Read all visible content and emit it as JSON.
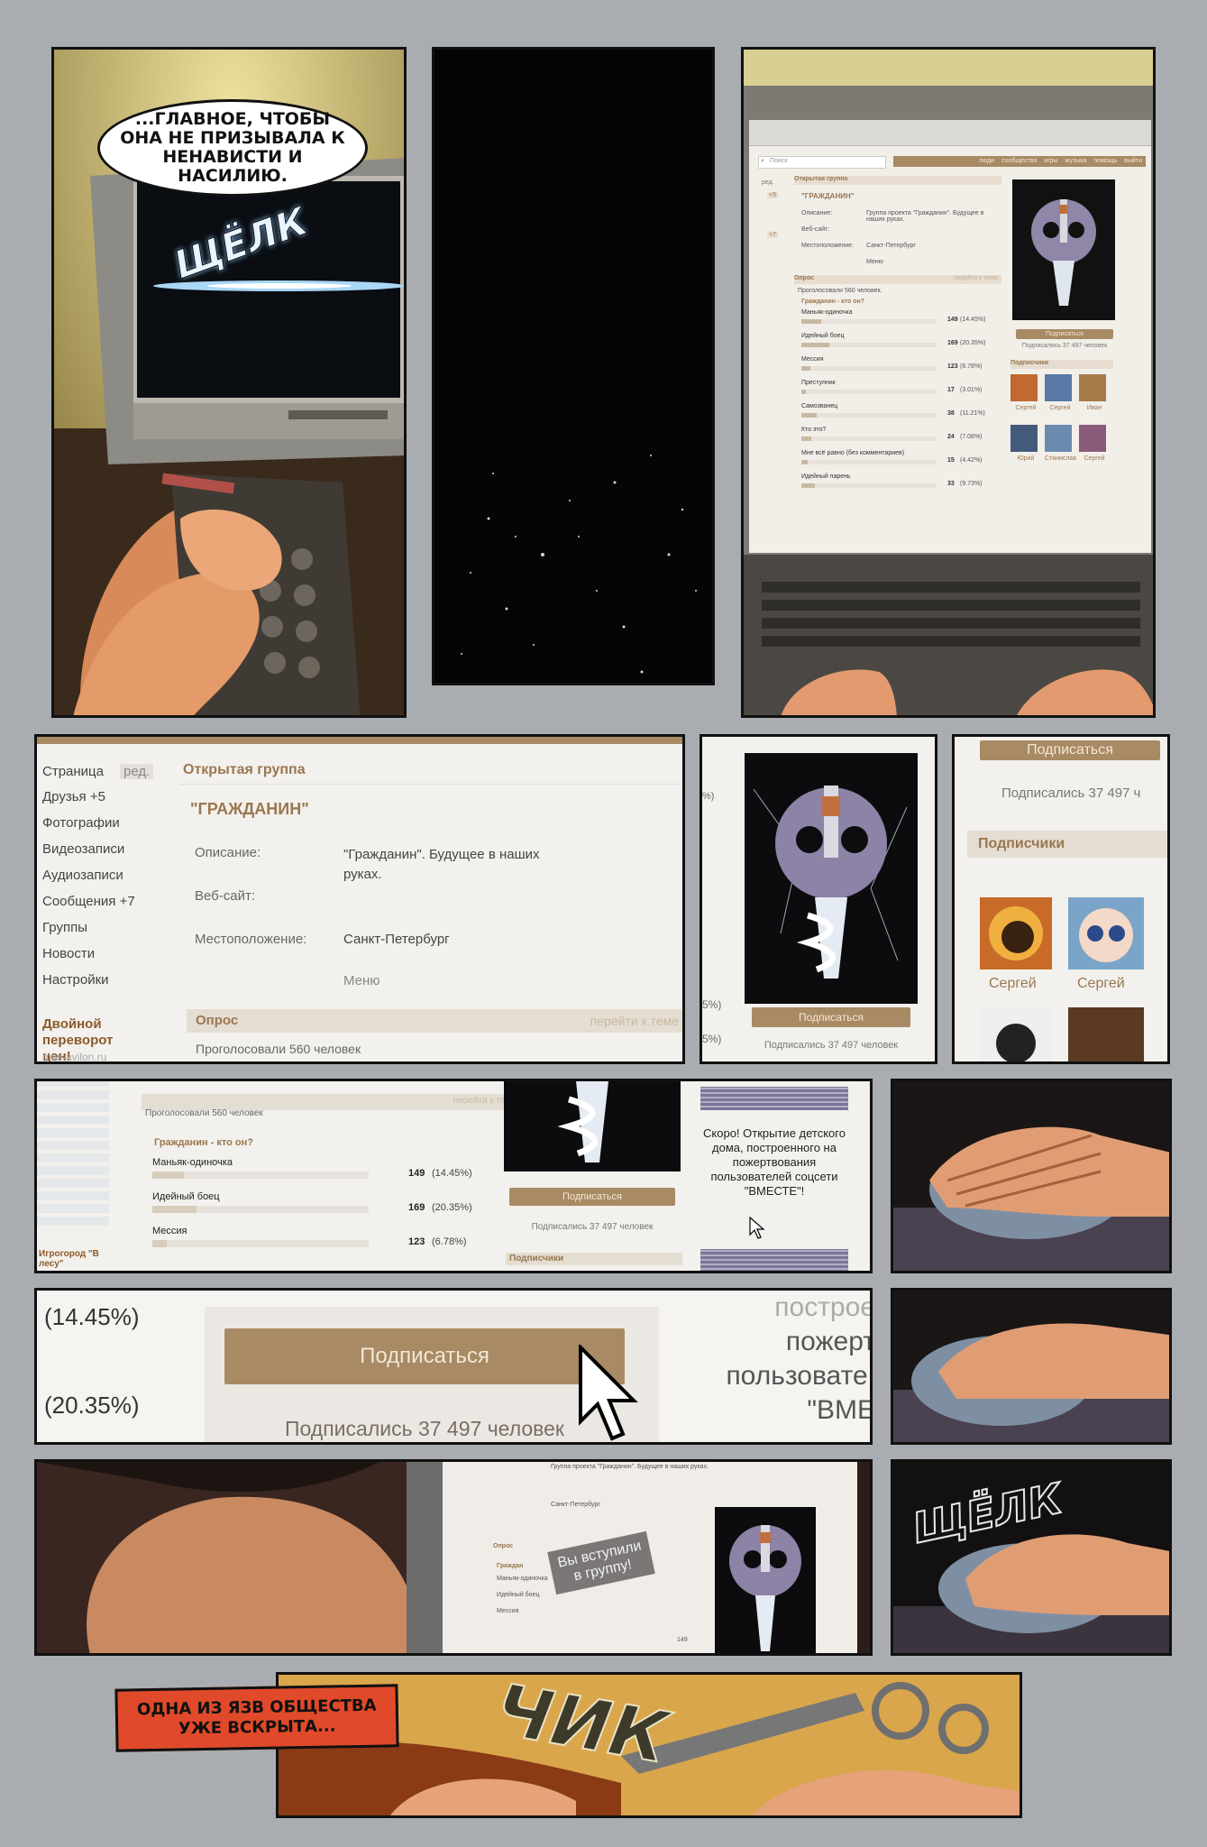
{
  "panel1": {
    "speech": "...главное, чтобы она не призывала к ненависти и насилию.",
    "sfx": "ЩЁЛК"
  },
  "vk_small": {
    "search_placeholder": "Поиск",
    "top_nav": [
      "люди",
      "сообщества",
      "игры",
      "музыка",
      "помощь",
      "выйти"
    ],
    "left_edit": "ред.",
    "left_badges": [
      "+5",
      "+7"
    ],
    "group_type": "Открытая группа",
    "group_name": "\"ГРАЖДАНИН\"",
    "desc_label": "Описание:",
    "desc_value": "Группа проекта \"Гражданин\". Будущее в наших руках.",
    "site_label": "Веб-сайт:",
    "location_label": "Местоположение:",
    "location_value": "Санкт-Петербург",
    "menu": "Меню",
    "poll_label": "Опрос",
    "poll_link": "перейти к теме",
    "poll_voted": "Проголосовали 560 человек.",
    "poll_question": "Гражданин - кто он?",
    "poll_options": [
      {
        "label": "Маньяк-одиночка",
        "count": "149",
        "pct": "(14.45%)",
        "share": 0.1445
      },
      {
        "label": "Идейный боец",
        "count": "169",
        "pct": "(20.35%)",
        "share": 0.2035
      },
      {
        "label": "Мессия",
        "count": "123",
        "pct": "(6.78%)",
        "share": 0.0678
      },
      {
        "label": "Преступник",
        "count": "17",
        "pct": "(3.01%)",
        "share": 0.0301
      },
      {
        "label": "Самозванец",
        "count": "38",
        "pct": "(11.21%)",
        "share": 0.1121
      },
      {
        "label": "Кто это?",
        "count": "24",
        "pct": "(7.08%)",
        "share": 0.0708
      },
      {
        "label": "Мне всё равно (без комментариев)",
        "count": "15",
        "pct": "(4.42%)",
        "share": 0.0442
      },
      {
        "label": "Идейный парень",
        "count": "33",
        "pct": "(9.73%)",
        "share": 0.0973
      }
    ],
    "subscribe_button": "Подписаться",
    "subscribed_count": "Подписались 37 497 человек",
    "subscribers_title": "Подписчики",
    "subscriber_names": [
      "Сергей",
      "Сергей",
      "Иван",
      "Юрий",
      "Станислав",
      "Сергей"
    ]
  },
  "panel4": {
    "left_menu": [
      "Страница",
      "Друзья +5",
      "Фотографии",
      "Видеозаписи",
      "Аудиозаписи",
      "Сообщения +7",
      "Группы",
      "Новости",
      "Настройки"
    ],
    "left_edit": "ред.",
    "ad_title": "Двойной переворот цен!",
    "ad_link": "mini-avilon.ru",
    "group_type": "Открытая группа",
    "group_name": "\"ГРАЖДАНИН\"",
    "desc_label": "Описание:",
    "desc_value": "\"Гражданин\". Будущее в наших руках.",
    "site_label": "Веб-сайт:",
    "location_label": "Местоположение:",
    "location_value": "Санкт-Петербург",
    "menu": "Меню",
    "poll_label": "Опрос",
    "poll_link": "перейти к теме",
    "poll_voted": "Проголосовали 560 человек"
  },
  "panel5": {
    "pcts": [
      "%)",
      "5%)",
      "5%)"
    ],
    "button": "Подписаться",
    "subscribed": "Подписались 37 497 человек"
  },
  "panel6": {
    "button": "Подписаться",
    "subscribed": "Подписались 37 497 ч",
    "subscribers_title": "Подписчики",
    "names": [
      "Сергей",
      "Сергей"
    ]
  },
  "panel7": {
    "poll_voted": "Проголосовали 560 человек",
    "poll_link": "перейти к теме",
    "question": "Гражданин - кто он?",
    "options": [
      {
        "label": "Маньяк-одиночка",
        "count": "149",
        "pct": "(14.45%)",
        "share": 0.1445
      },
      {
        "label": "Идейный боец",
        "count": "169",
        "pct": "(20.35%)",
        "share": 0.2035
      },
      {
        "label": "Мессия",
        "count": "123",
        "pct": "(6.78%)",
        "share": 0.0678
      }
    ],
    "ad_fragment": "Игрогород \"В лесу\"",
    "button": "Подписаться",
    "subscribed": "Подписались 37 497 человек",
    "subscribers_title": "Подписчики",
    "ad_text": "Скоро! Открытие детского дома, построенного на пожертвования пользователей соцсети \"ВМЕСТЕ\"!"
  },
  "panel9": {
    "pct1": "(14.45%)",
    "pct2": "(20.35%)",
    "button": "Подписаться",
    "subscribed": "Подписались 37 497 человек",
    "ad_lines": [
      "построе",
      "пожерт",
      "пользовате.",
      "\"ВМЕ"
    ]
  },
  "panel11": {
    "desc_fragment": "Группа проекта \"Гражданин\". Будущее в наших руках.",
    "location": "Санкт-Петербург",
    "poll": "Опрос",
    "poll_question": "Граждан",
    "options": [
      "Маньяк-одиночка",
      "Идейный боец",
      "Мессия"
    ],
    "joined_toast": "Вы вступили в группу!",
    "count": "149"
  },
  "panel12": {
    "sfx": "ЩЁЛК"
  },
  "panel13": {
    "caption": "Одна из язв общества уже вскрыта...",
    "sfx": "ЧИК"
  },
  "colors": {
    "site_brown": "#a88a64",
    "site_bg": "#f4f2ee",
    "gutter": "#a9adb1",
    "caption_red": "#e04a2a"
  }
}
